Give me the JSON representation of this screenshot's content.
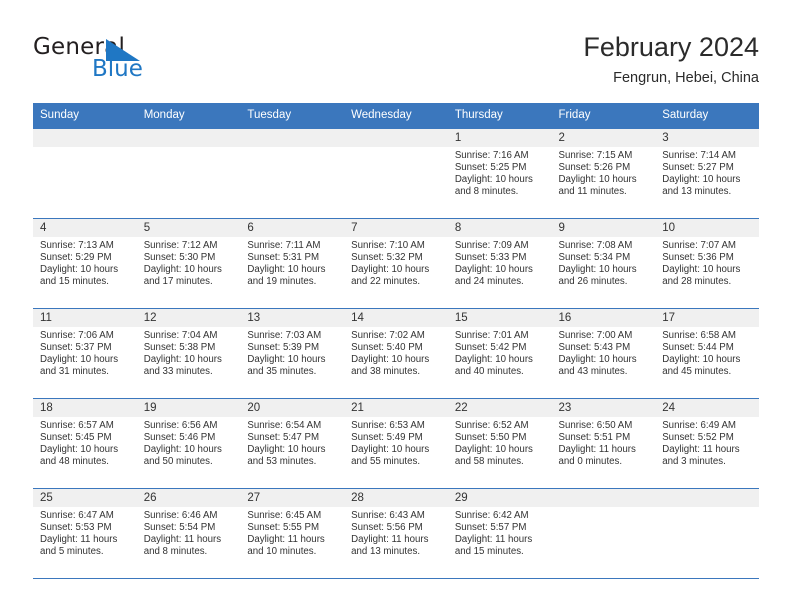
{
  "brand": {
    "name_part1": "General",
    "name_part2": "Blue",
    "logo_icon": "triangle-flag-icon",
    "accent_color": "#1f77c4"
  },
  "header": {
    "title": "February 2024",
    "location": "Fengrun, Hebei, China"
  },
  "calendar": {
    "header_color": "#3b77bd",
    "daynum_band_color": "#f0f0f0",
    "weekdays": [
      "Sunday",
      "Monday",
      "Tuesday",
      "Wednesday",
      "Thursday",
      "Friday",
      "Saturday"
    ],
    "weeks": [
      [
        {
          "day": "",
          "sunrise": "",
          "sunset": "",
          "daylight1": "",
          "daylight2": "",
          "empty": true
        },
        {
          "day": "",
          "sunrise": "",
          "sunset": "",
          "daylight1": "",
          "daylight2": "",
          "empty": true
        },
        {
          "day": "",
          "sunrise": "",
          "sunset": "",
          "daylight1": "",
          "daylight2": "",
          "empty": true
        },
        {
          "day": "",
          "sunrise": "",
          "sunset": "",
          "daylight1": "",
          "daylight2": "",
          "empty": true
        },
        {
          "day": "1",
          "sunrise": "Sunrise: 7:16 AM",
          "sunset": "Sunset: 5:25 PM",
          "daylight1": "Daylight: 10 hours",
          "daylight2": "and 8 minutes.",
          "empty": false
        },
        {
          "day": "2",
          "sunrise": "Sunrise: 7:15 AM",
          "sunset": "Sunset: 5:26 PM",
          "daylight1": "Daylight: 10 hours",
          "daylight2": "and 11 minutes.",
          "empty": false
        },
        {
          "day": "3",
          "sunrise": "Sunrise: 7:14 AM",
          "sunset": "Sunset: 5:27 PM",
          "daylight1": "Daylight: 10 hours",
          "daylight2": "and 13 minutes.",
          "empty": false
        }
      ],
      [
        {
          "day": "4",
          "sunrise": "Sunrise: 7:13 AM",
          "sunset": "Sunset: 5:29 PM",
          "daylight1": "Daylight: 10 hours",
          "daylight2": "and 15 minutes.",
          "empty": false
        },
        {
          "day": "5",
          "sunrise": "Sunrise: 7:12 AM",
          "sunset": "Sunset: 5:30 PM",
          "daylight1": "Daylight: 10 hours",
          "daylight2": "and 17 minutes.",
          "empty": false
        },
        {
          "day": "6",
          "sunrise": "Sunrise: 7:11 AM",
          "sunset": "Sunset: 5:31 PM",
          "daylight1": "Daylight: 10 hours",
          "daylight2": "and 19 minutes.",
          "empty": false
        },
        {
          "day": "7",
          "sunrise": "Sunrise: 7:10 AM",
          "sunset": "Sunset: 5:32 PM",
          "daylight1": "Daylight: 10 hours",
          "daylight2": "and 22 minutes.",
          "empty": false
        },
        {
          "day": "8",
          "sunrise": "Sunrise: 7:09 AM",
          "sunset": "Sunset: 5:33 PM",
          "daylight1": "Daylight: 10 hours",
          "daylight2": "and 24 minutes.",
          "empty": false
        },
        {
          "day": "9",
          "sunrise": "Sunrise: 7:08 AM",
          "sunset": "Sunset: 5:34 PM",
          "daylight1": "Daylight: 10 hours",
          "daylight2": "and 26 minutes.",
          "empty": false
        },
        {
          "day": "10",
          "sunrise": "Sunrise: 7:07 AM",
          "sunset": "Sunset: 5:36 PM",
          "daylight1": "Daylight: 10 hours",
          "daylight2": "and 28 minutes.",
          "empty": false
        }
      ],
      [
        {
          "day": "11",
          "sunrise": "Sunrise: 7:06 AM",
          "sunset": "Sunset: 5:37 PM",
          "daylight1": "Daylight: 10 hours",
          "daylight2": "and 31 minutes.",
          "empty": false
        },
        {
          "day": "12",
          "sunrise": "Sunrise: 7:04 AM",
          "sunset": "Sunset: 5:38 PM",
          "daylight1": "Daylight: 10 hours",
          "daylight2": "and 33 minutes.",
          "empty": false
        },
        {
          "day": "13",
          "sunrise": "Sunrise: 7:03 AM",
          "sunset": "Sunset: 5:39 PM",
          "daylight1": "Daylight: 10 hours",
          "daylight2": "and 35 minutes.",
          "empty": false
        },
        {
          "day": "14",
          "sunrise": "Sunrise: 7:02 AM",
          "sunset": "Sunset: 5:40 PM",
          "daylight1": "Daylight: 10 hours",
          "daylight2": "and 38 minutes.",
          "empty": false
        },
        {
          "day": "15",
          "sunrise": "Sunrise: 7:01 AM",
          "sunset": "Sunset: 5:42 PM",
          "daylight1": "Daylight: 10 hours",
          "daylight2": "and 40 minutes.",
          "empty": false
        },
        {
          "day": "16",
          "sunrise": "Sunrise: 7:00 AM",
          "sunset": "Sunset: 5:43 PM",
          "daylight1": "Daylight: 10 hours",
          "daylight2": "and 43 minutes.",
          "empty": false
        },
        {
          "day": "17",
          "sunrise": "Sunrise: 6:58 AM",
          "sunset": "Sunset: 5:44 PM",
          "daylight1": "Daylight: 10 hours",
          "daylight2": "and 45 minutes.",
          "empty": false
        }
      ],
      [
        {
          "day": "18",
          "sunrise": "Sunrise: 6:57 AM",
          "sunset": "Sunset: 5:45 PM",
          "daylight1": "Daylight: 10 hours",
          "daylight2": "and 48 minutes.",
          "empty": false
        },
        {
          "day": "19",
          "sunrise": "Sunrise: 6:56 AM",
          "sunset": "Sunset: 5:46 PM",
          "daylight1": "Daylight: 10 hours",
          "daylight2": "and 50 minutes.",
          "empty": false
        },
        {
          "day": "20",
          "sunrise": "Sunrise: 6:54 AM",
          "sunset": "Sunset: 5:47 PM",
          "daylight1": "Daylight: 10 hours",
          "daylight2": "and 53 minutes.",
          "empty": false
        },
        {
          "day": "21",
          "sunrise": "Sunrise: 6:53 AM",
          "sunset": "Sunset: 5:49 PM",
          "daylight1": "Daylight: 10 hours",
          "daylight2": "and 55 minutes.",
          "empty": false
        },
        {
          "day": "22",
          "sunrise": "Sunrise: 6:52 AM",
          "sunset": "Sunset: 5:50 PM",
          "daylight1": "Daylight: 10 hours",
          "daylight2": "and 58 minutes.",
          "empty": false
        },
        {
          "day": "23",
          "sunrise": "Sunrise: 6:50 AM",
          "sunset": "Sunset: 5:51 PM",
          "daylight1": "Daylight: 11 hours",
          "daylight2": "and 0 minutes.",
          "empty": false
        },
        {
          "day": "24",
          "sunrise": "Sunrise: 6:49 AM",
          "sunset": "Sunset: 5:52 PM",
          "daylight1": "Daylight: 11 hours",
          "daylight2": "and 3 minutes.",
          "empty": false
        }
      ],
      [
        {
          "day": "25",
          "sunrise": "Sunrise: 6:47 AM",
          "sunset": "Sunset: 5:53 PM",
          "daylight1": "Daylight: 11 hours",
          "daylight2": "and 5 minutes.",
          "empty": false
        },
        {
          "day": "26",
          "sunrise": "Sunrise: 6:46 AM",
          "sunset": "Sunset: 5:54 PM",
          "daylight1": "Daylight: 11 hours",
          "daylight2": "and 8 minutes.",
          "empty": false
        },
        {
          "day": "27",
          "sunrise": "Sunrise: 6:45 AM",
          "sunset": "Sunset: 5:55 PM",
          "daylight1": "Daylight: 11 hours",
          "daylight2": "and 10 minutes.",
          "empty": false
        },
        {
          "day": "28",
          "sunrise": "Sunrise: 6:43 AM",
          "sunset": "Sunset: 5:56 PM",
          "daylight1": "Daylight: 11 hours",
          "daylight2": "and 13 minutes.",
          "empty": false
        },
        {
          "day": "29",
          "sunrise": "Sunrise: 6:42 AM",
          "sunset": "Sunset: 5:57 PM",
          "daylight1": "Daylight: 11 hours",
          "daylight2": "and 15 minutes.",
          "empty": false
        },
        {
          "day": "",
          "sunrise": "",
          "sunset": "",
          "daylight1": "",
          "daylight2": "",
          "empty": true
        },
        {
          "day": "",
          "sunrise": "",
          "sunset": "",
          "daylight1": "",
          "daylight2": "",
          "empty": true
        }
      ]
    ]
  }
}
